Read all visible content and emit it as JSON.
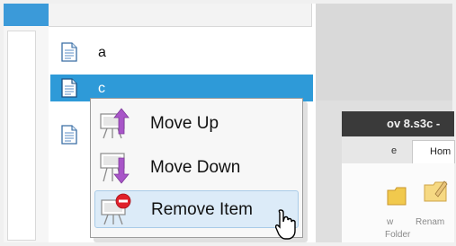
{
  "list": {
    "items": [
      {
        "label": "a",
        "icon": "document-icon",
        "selected": false
      },
      {
        "label": "c",
        "icon": "document-icon",
        "selected": true
      },
      {
        "label": "",
        "icon": "document-icon",
        "selected": false
      }
    ]
  },
  "app_window": {
    "title": "ov 8.s3c -",
    "tab_file": "e",
    "tab_home": "Hom",
    "ribbon_new": "w",
    "ribbon_folder": "Folder",
    "ribbon_rename": "Renam"
  },
  "context_menu": {
    "items": [
      {
        "label": "Move Up",
        "icon": "move-up-icon"
      },
      {
        "label": "Move Down",
        "icon": "move-down-icon"
      },
      {
        "label": "Remove Item",
        "icon": "remove-item-icon",
        "hovered": true
      }
    ]
  },
  "colors": {
    "selection": "#2e9ad8",
    "menu_hover": "#dcebf8",
    "arrow_purple": "#a855c8",
    "remove_red": "#e0202a"
  }
}
